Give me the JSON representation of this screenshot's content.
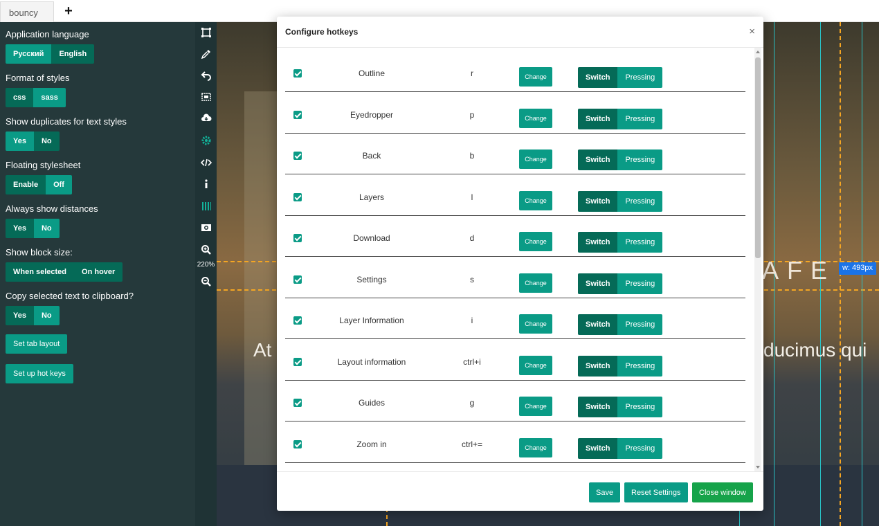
{
  "tabs": [
    {
      "label": "bouncy"
    }
  ],
  "settings": {
    "language": {
      "label": "Application language",
      "options": [
        "Русский",
        "English"
      ]
    },
    "format": {
      "label": "Format of styles",
      "options": [
        "css",
        "sass"
      ]
    },
    "duplicates": {
      "label": "Show duplicates for text styles",
      "options": [
        "Yes",
        "No"
      ]
    },
    "floating": {
      "label": "Floating stylesheet",
      "options": [
        "Enable",
        "Off"
      ]
    },
    "distances": {
      "label": "Always show distances",
      "options": [
        "Yes",
        "No"
      ]
    },
    "block_size": {
      "label": "Show block size:",
      "options": [
        "When selected",
        "On hover"
      ]
    },
    "copy_text": {
      "label": "Copy selected text to clipboard?",
      "options": [
        "Yes",
        "No"
      ]
    },
    "tab_layout_button": "Set tab layout",
    "hot_keys_button": "Set up hot keys"
  },
  "toolbar": {
    "zoom_level": "220%",
    "icons": [
      "outline-icon",
      "eyedropper-icon",
      "back-icon",
      "layers-icon",
      "download-icon",
      "settings-icon",
      "code-icon",
      "info-icon",
      "guides-icon",
      "image-icon",
      "zoom-in-icon",
      "zoom-out-icon"
    ]
  },
  "canvas": {
    "heading": "AFE",
    "text_left": "At",
    "text_right": "ducimus qui",
    "width_badge": "w: 493px"
  },
  "modal": {
    "title": "Configure hotkeys",
    "close": "×",
    "change_label": "Change",
    "switch_label": "Switch",
    "pressing_label": "Pressing",
    "rows": [
      {
        "name": "Outline",
        "key": "r"
      },
      {
        "name": "Eyedropper",
        "key": "p"
      },
      {
        "name": "Back",
        "key": "b"
      },
      {
        "name": "Layers",
        "key": "l"
      },
      {
        "name": "Download",
        "key": "d"
      },
      {
        "name": "Settings",
        "key": "s"
      },
      {
        "name": "Layer Information",
        "key": "i"
      },
      {
        "name": "Layout information",
        "key": "ctrl+i"
      },
      {
        "name": "Guides",
        "key": "g"
      },
      {
        "name": "Zoom in",
        "key": "ctrl+="
      }
    ],
    "footer": {
      "save": "Save",
      "reset": "Reset Settings",
      "close": "Close window"
    }
  },
  "colors": {
    "accent": "#0a9b86",
    "dark_accent": "#056a57",
    "close_green": "#16a34a",
    "panel": "#25393b"
  }
}
